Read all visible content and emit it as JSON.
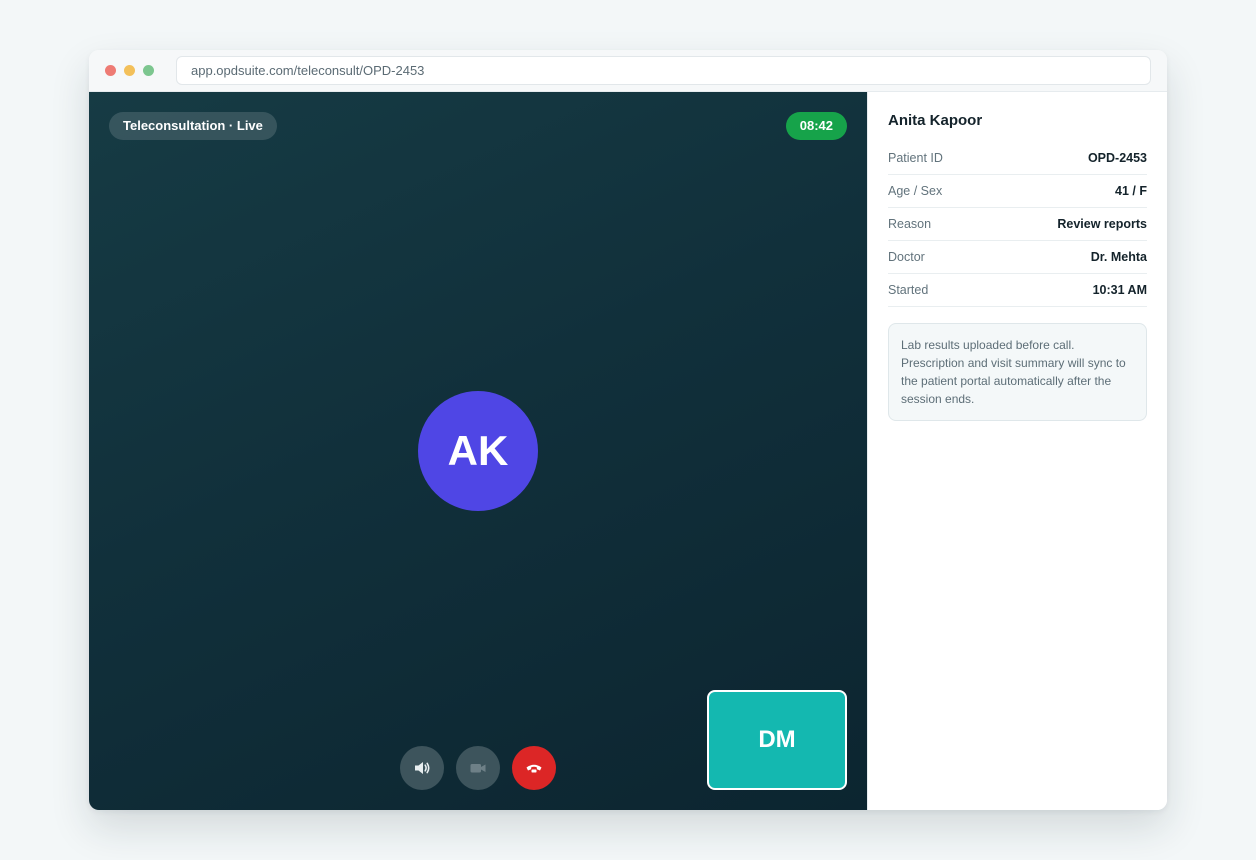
{
  "browser": {
    "url": "app.opdsuite.com/teleconsult/OPD-2453"
  },
  "call": {
    "status_label": "Teleconsultation · Live",
    "timer": "08:42",
    "remote_initials": "AK",
    "self_initials": "DM",
    "controls": [
      {
        "name": "speaker",
        "icon": "speaker-icon"
      },
      {
        "name": "camera",
        "icon": "video-camera-icon"
      },
      {
        "name": "end-call",
        "icon": "phone-hangup-icon",
        "color": "#dc2626"
      }
    ],
    "colors": {
      "remote_avatar": "#4f46e5",
      "self_view": "#14b8b0",
      "live_timer": "#16a34a"
    }
  },
  "patient": {
    "name": "Anita Kapoor",
    "rows": [
      {
        "label": "Patient ID",
        "value": "OPD-2453"
      },
      {
        "label": "Age / Sex",
        "value": "41 / F"
      },
      {
        "label": "Reason",
        "value": "Review reports"
      },
      {
        "label": "Doctor",
        "value": "Dr. Mehta"
      },
      {
        "label": "Started",
        "value": "10:31 AM"
      }
    ],
    "note": "Lab results uploaded before call. Prescription and visit summary will sync to the patient portal automatically after the session ends."
  }
}
